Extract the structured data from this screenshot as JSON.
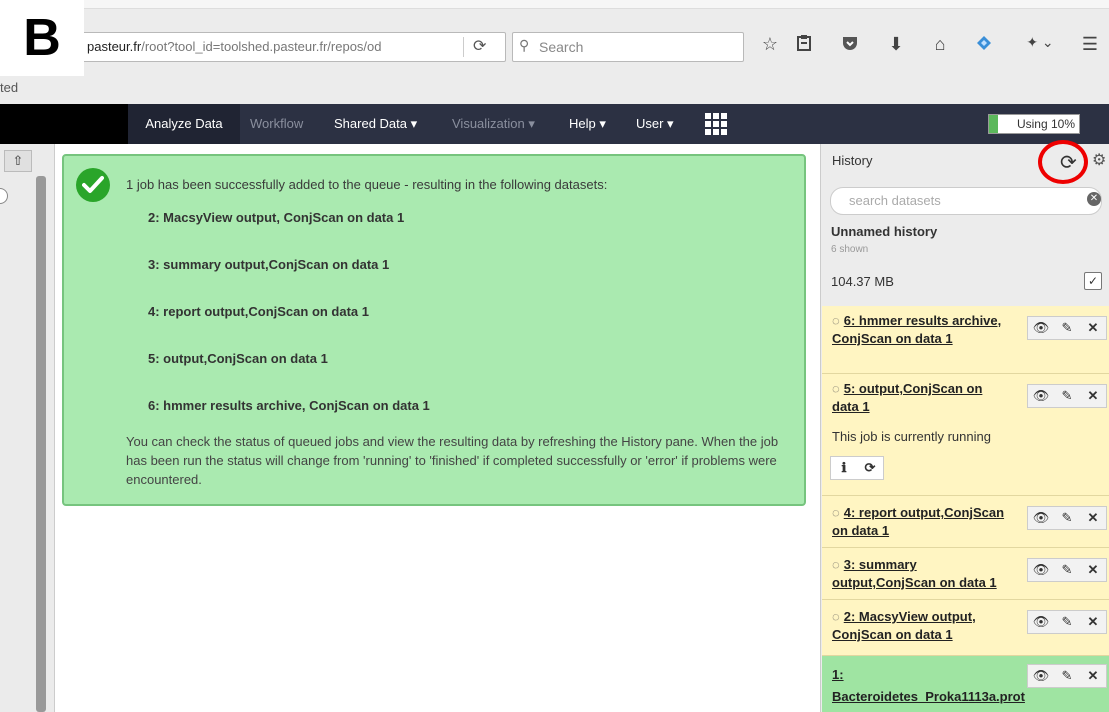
{
  "figure": {
    "panel_label": "B"
  },
  "browser": {
    "url_domain": "pasteur.fr",
    "url_rest": "/root?tool_id=toolshed.pasteur.fr/repos/od",
    "search_placeholder": "Search",
    "left_fragment": "ted",
    "icons": [
      "star-icon",
      "clipboard-icon",
      "pocket-icon",
      "download-icon",
      "home-icon",
      "diamond-icon",
      "extension-icon",
      "menu-icon"
    ]
  },
  "masthead": {
    "nav": [
      {
        "label": "Analyze Data",
        "state": "active"
      },
      {
        "label": "Workflow",
        "state": "dim"
      },
      {
        "label": "Shared Data ▾",
        "state": "normal"
      },
      {
        "label": "Visualization ▾",
        "state": "dim"
      },
      {
        "label": "Help ▾",
        "state": "normal"
      },
      {
        "label": "User ▾",
        "state": "normal"
      }
    ],
    "quota_label": "Using 10%",
    "quota_percent": 10,
    "quota_color": "#5cb85c"
  },
  "message": {
    "headline": "1 job has been successfully added to the queue - resulting in the following datasets:",
    "datasets": [
      "2: MacsyView output, ConjScan on data 1",
      "3: summary output,ConjScan on data 1",
      "4: report output,ConjScan on data 1",
      "5: output,ConjScan on data 1",
      "6: hmmer results archive, ConjScan on data 1"
    ],
    "footer": "You can check the status of queued jobs and view the resulting data by refreshing the History pane. When the job has been run the status will change from 'running' to 'finished' if completed successfully or 'error' if problems were encountered."
  },
  "history": {
    "title": "History",
    "search_placeholder": "search datasets",
    "name": "Unnamed history",
    "shown": "6 shown",
    "size": "104.37 MB",
    "items": [
      {
        "title": "6: hmmer results archive, ConjScan on data 1",
        "state": "queued"
      },
      {
        "title": "5: output,ConjScan on data 1",
        "state": "running",
        "status_text": "This job is currently running"
      },
      {
        "title": "4: report output,ConjScan on data 1",
        "state": "queued"
      },
      {
        "title": "3: summary output,ConjScan on data 1",
        "state": "queued"
      },
      {
        "title": "2: MacsyView output, ConjScan on data 1",
        "state": "queued"
      },
      {
        "title": "1: Bacteroidetes_Proka1113a.prot",
        "state": "ok"
      }
    ]
  }
}
